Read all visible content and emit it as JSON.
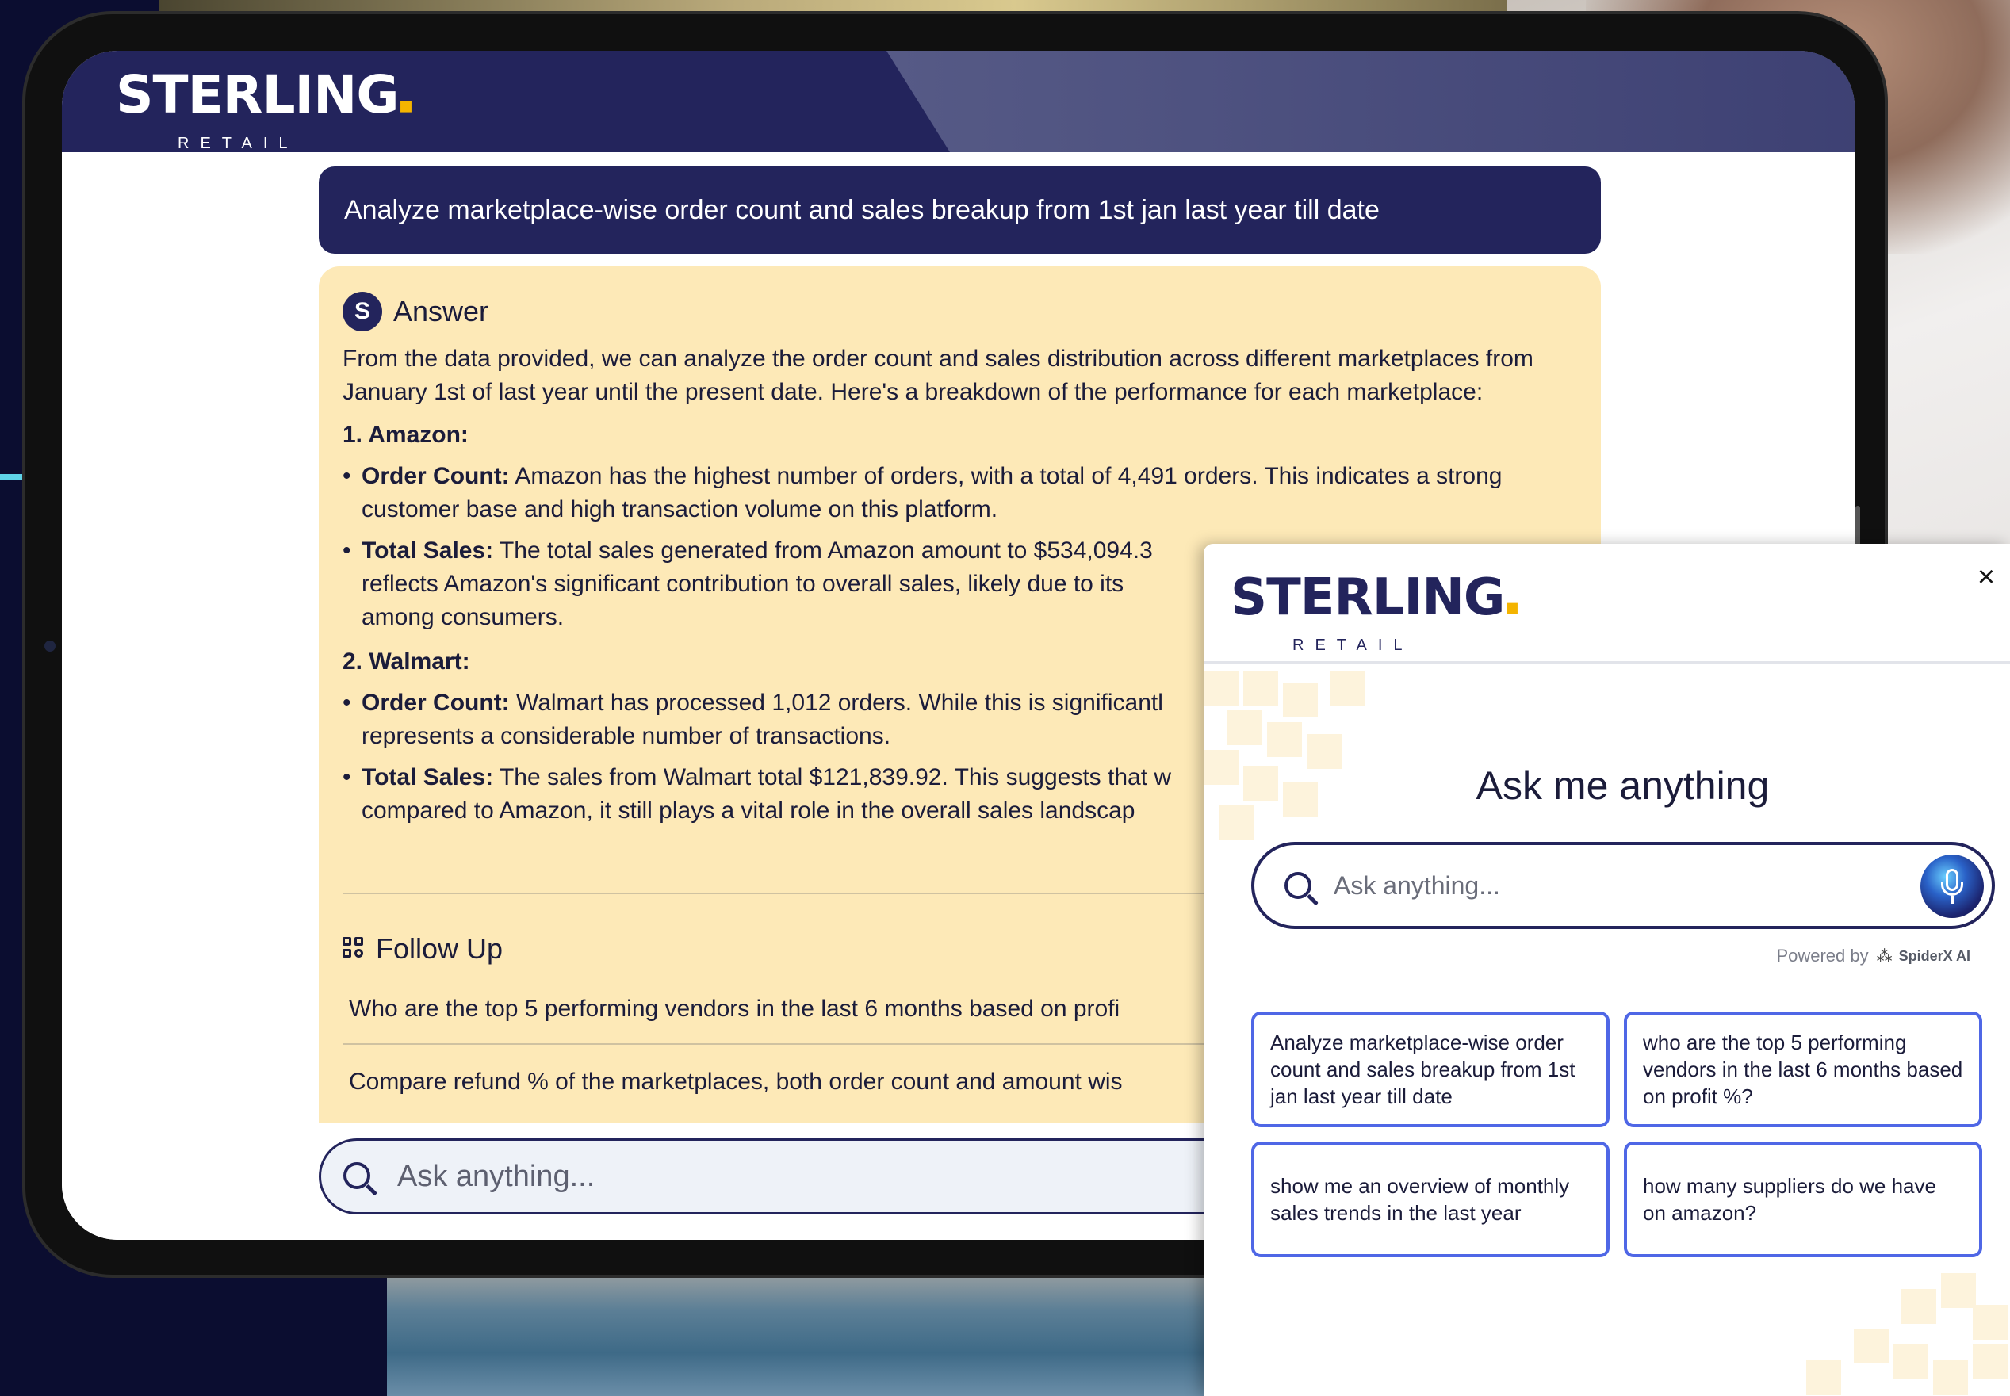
{
  "brand": {
    "name": "STERLING",
    "sub": "RETAIL"
  },
  "chat": {
    "question": "Analyze marketplace-wise order count and sales breakup from 1st jan last year till date",
    "answer_label": "Answer",
    "answer_icon_letter": "S",
    "intro": "From the data provided, we can analyze the order count and sales distribution across different marketplaces from January 1st of last year until the present date. Here's a breakdown of the performance for each marketplace:",
    "sections": [
      {
        "heading": "1. Amazon:",
        "bullets": [
          {
            "label": "Order Count:",
            "text": " Amazon has the highest number of orders, with a total of 4,491 orders. This indicates a strong customer base and high transaction volume on this platform."
          },
          {
            "label": "Total Sales:",
            "text": " The total sales generated from Amazon amount to $534,094.3"
          },
          {
            "label": "",
            "text": "reflects Amazon's significant contribution to overall sales, likely due to its"
          },
          {
            "label": "",
            "text": "among consumers."
          }
        ]
      },
      {
        "heading": "2. Walmart:",
        "bullets": [
          {
            "label": "Order Count:",
            "text": " Walmart has processed 1,012 orders. While this is significantl"
          },
          {
            "label": "",
            "text": "represents a considerable number of transactions."
          },
          {
            "label": "Total Sales:",
            "text": " The sales from Walmart total $121,839.92. This suggests that w"
          },
          {
            "label": "",
            "text": "compared to Amazon, it still plays a vital role in the overall sales landscap"
          }
        ]
      }
    ],
    "follow_up_label": "Follow Up",
    "follow_ups": [
      "Who are the top 5 performing vendors in the last 6 months based on profi",
      "Compare refund % of the marketplaces, both order count and amount wis"
    ],
    "search_placeholder": "Ask anything..."
  },
  "popup": {
    "close_label": "×",
    "title": "Ask me anything",
    "search_placeholder": "Ask anything...",
    "powered_by": "Powered by",
    "powered_brand": "SpiderX AI",
    "suggestions": [
      "Analyze marketplace-wise order count and sales breakup from 1st jan last year till date",
      "who are the top 5 performing vendors in the last 6 months based on profit %?",
      "show me an overview of monthly sales trends in the last year",
      "how many suppliers do we have on amazon?"
    ]
  },
  "colors": {
    "navy": "#23245c",
    "accent_gold": "#f4b400",
    "answer_bg": "#fde9b7",
    "suggestion_border": "#4f67e6"
  }
}
